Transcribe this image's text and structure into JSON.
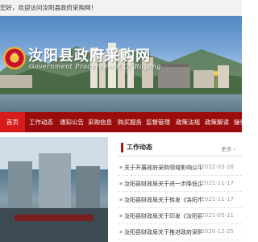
{
  "topbar": {
    "welcome": "您好，欢迎访问汝阳县政府采购网！"
  },
  "banner": {
    "title": "汝阳县政府采购网",
    "subtitle": "Government Procurement Of Ruyang"
  },
  "nav": {
    "items": [
      {
        "label": "首页"
      },
      {
        "label": "工作动态"
      },
      {
        "label": "通知公告"
      },
      {
        "label": "采购信息"
      },
      {
        "label": "购买服务"
      },
      {
        "label": "监督管理"
      },
      {
        "label": "政策法规"
      },
      {
        "label": "政策解读"
      },
      {
        "label": "操作"
      }
    ]
  },
  "news": {
    "title": "工作动态",
    "more": "更多 ›",
    "items": [
      {
        "text": "关于开展政府采购领域影响公平竞争问题专项整治的通知",
        "date": "2022-03-28"
      },
      {
        "text": "汝阳县财政局关于进一步降低企业政府采购成本的通知",
        "date": "2021-11-17"
      },
      {
        "text": "汝阳县财政局关于转发《洛阳市政府采购负面清单》的通知",
        "date": "2021-11-17"
      },
      {
        "text": "汝阳县财政局关于印发《汝阳县政府采购内部控制办法》的通知",
        "date": "2021-05-11"
      },
      {
        "text": "汝阳县财政局关于推进政府采购信用体系建设的通知",
        "date": "2020-12-25"
      }
    ]
  },
  "colors": {
    "nav_bg": "#9b0d0d",
    "nav_active": "#d61b1b",
    "accent": "#b3140f"
  }
}
